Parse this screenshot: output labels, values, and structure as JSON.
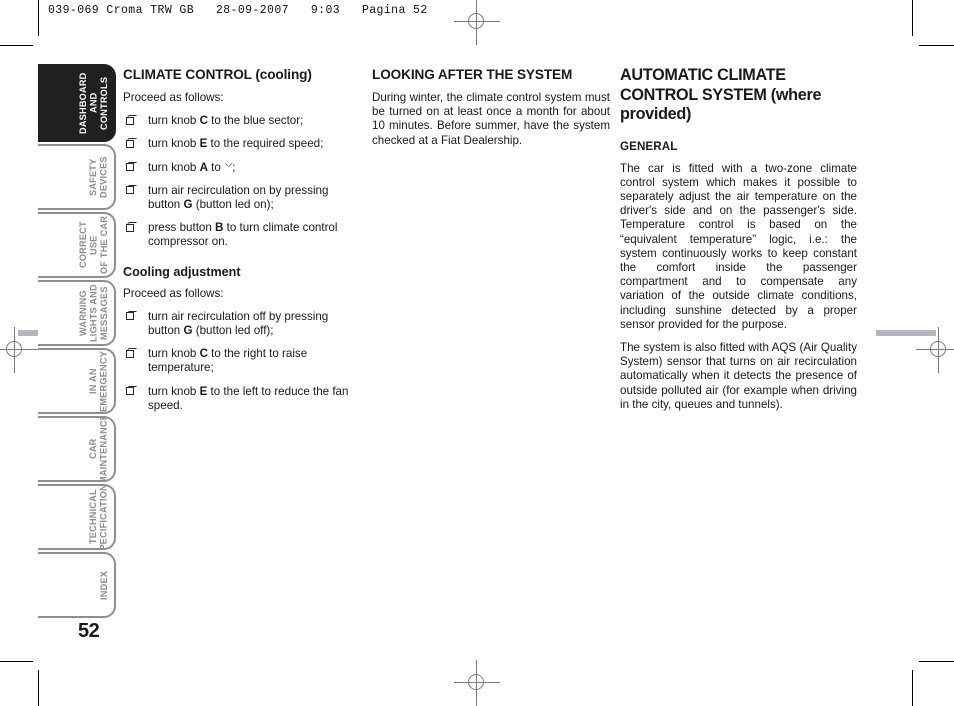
{
  "running_head": "039-069 Croma TRW GB   28-09-2007   9:03   Pagina 52",
  "page_number": "52",
  "sidebar": {
    "tabs": [
      {
        "label": "DASHBOARD\nAND CONTROLS",
        "active": true
      },
      {
        "label": "SAFETY\nDEVICES",
        "active": false
      },
      {
        "label": "CORRECT USE\nOF THE CAR",
        "active": false
      },
      {
        "label": "WARNING\nLIGHTS AND\nMESSAGES",
        "active": false
      },
      {
        "label": "IN AN\nEMERGENCY",
        "active": false
      },
      {
        "label": "CAR\nMAINTENANCE",
        "active": false
      },
      {
        "label": "TECHNICAL\nSPECIFICATIONS",
        "active": false
      },
      {
        "label": "INDEX",
        "active": false
      }
    ]
  },
  "column1": {
    "heading": "CLIMATE CONTROL (cooling)",
    "lead": "Proceed as follows:",
    "bullets": [
      {
        "pre": "turn knob ",
        "key": "C",
        "post": " to the blue sector;"
      },
      {
        "pre": "turn knob ",
        "key": "E",
        "post": " to the required speed;"
      },
      {
        "pre": "turn knob ",
        "key": "A",
        "post": " to ",
        "symbol": "air-vent-symbol",
        "tail": ";"
      },
      {
        "pre": "turn air recirculation on by pressing button ",
        "key": "G",
        "post": " (button led on);"
      },
      {
        "pre": "press button ",
        "key": "B",
        "post": " to turn climate control compressor on."
      }
    ],
    "sub_heading": "Cooling adjustment",
    "sub_lead": "Proceed as follows:",
    "sub_bullets": [
      {
        "pre": "turn air recirculation off by pressing button ",
        "key": "G",
        "post": " (button led off);"
      },
      {
        "pre": "turn knob ",
        "key": "C",
        "post": " to the right to raise temperature;"
      },
      {
        "pre": "turn knob ",
        "key": "E",
        "post": " to the left to reduce the fan speed."
      }
    ]
  },
  "column2": {
    "heading": "LOOKING AFTER THE SYSTEM",
    "paragraph": "During winter, the climate control system must be turned on at least once a month for about 10 minutes. Before summer, have the system checked at a Fiat Dealership."
  },
  "column3": {
    "heading": "AUTOMATIC CLIMATE CONTROL SYSTEM (where provided)",
    "sub_heading": "GENERAL",
    "paragraph1": "The car is fitted with a two-zone climate control system which makes it possible to separately adjust the air temperature on the driver's side and on the passenger's side. Temperature control is based on the “equivalent temperature” logic, i.e.: the system continuously works to keep constant the comfort inside the passenger compartment and to compensate any variation of the outside climate conditions, including sunshine detected by a proper sensor provided for the purpose.",
    "paragraph2": "The system is also fitted with AQS (Air Quality System) sensor that turns on air recirculation automatically when it detects the presence of outside polluted air (for example when driving in the city, queues and tunnels)."
  },
  "print_marks": {
    "registration_icon": "registration-target-icon",
    "crop_icon": "crop-mark"
  },
  "colors": {
    "active_tab_bg": "#211f1f",
    "tab_border": "#8e8e96",
    "tab_text": "#8b8b93",
    "reg_mark": "#7a7a86",
    "text": "#1a1a1a"
  }
}
